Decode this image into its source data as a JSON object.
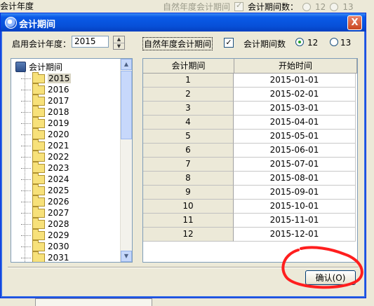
{
  "background": {
    "title": "会计年度",
    "natural_label": "自然年度会计期间",
    "count_label": "会计期间数：",
    "radio_12": "12",
    "radio_13": "13"
  },
  "dialog": {
    "title": "会计期间",
    "close": "X",
    "year_label": "启用会计年度：",
    "year_value": "2015",
    "natural_label": "自然年度会计期间",
    "natural_checked": "✓",
    "count_label": "会计期间数",
    "radio_12": "12",
    "radio_13": "13",
    "ok_label": "确认(O)"
  },
  "tree": {
    "root": "会计期间",
    "items": [
      "2015",
      "2016",
      "2017",
      "2018",
      "2019",
      "2020",
      "2021",
      "2022",
      "2023",
      "2024",
      "2025",
      "2026",
      "2027",
      "2028",
      "2029",
      "2030",
      "2031"
    ],
    "selected": "2015"
  },
  "table": {
    "headers": [
      "会计期间",
      "开始时间"
    ],
    "rows": [
      [
        "1",
        "2015-01-01"
      ],
      [
        "2",
        "2015-02-01"
      ],
      [
        "3",
        "2015-03-01"
      ],
      [
        "4",
        "2015-04-01"
      ],
      [
        "5",
        "2015-05-01"
      ],
      [
        "6",
        "2015-06-01"
      ],
      [
        "7",
        "2015-07-01"
      ],
      [
        "8",
        "2015-08-01"
      ],
      [
        "9",
        "2015-09-01"
      ],
      [
        "10",
        "2015-10-01"
      ],
      [
        "11",
        "2015-11-01"
      ],
      [
        "12",
        "2015-12-01"
      ]
    ]
  },
  "colors": {
    "annotation": "#ff1e1e",
    "titlebar": "#0a5be8"
  }
}
